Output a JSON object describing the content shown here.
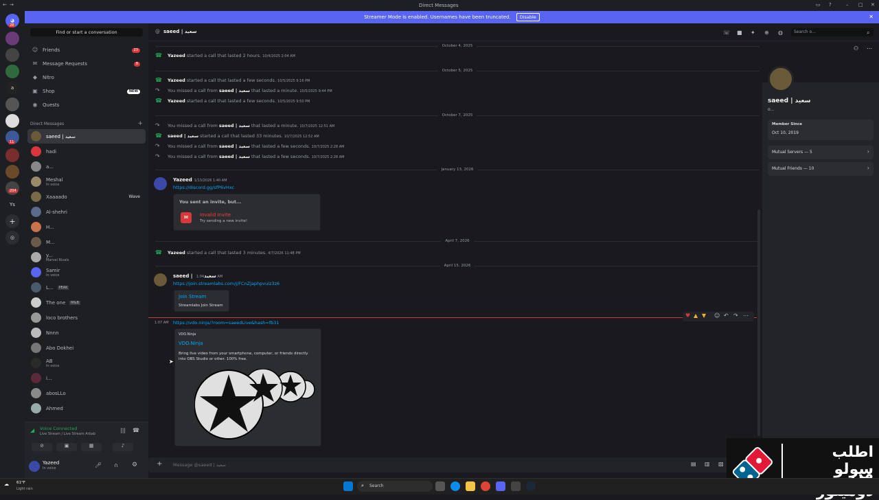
{
  "titlebar": {
    "title": "Direct Messages"
  },
  "banner": {
    "text": "Streamer Mode is enabled. Usernames have been truncated.",
    "button": "Disable"
  },
  "guilds": {
    "badges": [
      "28",
      "11",
      "204"
    ],
    "ys": "Ys"
  },
  "sidebar": {
    "search": "Find or start a conversation",
    "nav": [
      {
        "label": "Friends",
        "badge": "23"
      },
      {
        "label": "Message Requests",
        "badge": "8"
      },
      {
        "label": "Nitro"
      },
      {
        "label": "Shop",
        "badge": "NEW"
      },
      {
        "label": "Quests"
      }
    ],
    "dm_header": "Direct Messages",
    "dms": [
      {
        "name": "saeed | سعيد"
      },
      {
        "name": "hadi"
      },
      {
        "name": "a..."
      },
      {
        "name": "Meshal",
        "sub": "In voice"
      },
      {
        "name": "Xaaaado",
        "wave": "Wave"
      },
      {
        "name": "Al-shehri"
      },
      {
        "name": "H..."
      },
      {
        "name": "M..."
      },
      {
        "name": "y...",
        "sub": "Marvel Rivals"
      },
      {
        "name": "Samir",
        "sub": "In voice"
      },
      {
        "name": "L...",
        "tag": "PEAK"
      },
      {
        "name": "The one",
        "tag": "M&B"
      },
      {
        "name": "loco brothers"
      },
      {
        "name": "Nnnn"
      },
      {
        "name": "Abo Dokhei"
      },
      {
        "name": "AB",
        "sub": "In voice"
      },
      {
        "name": "i..."
      },
      {
        "name": "abosLLo"
      },
      {
        "name": "Ahmed"
      }
    ],
    "voice": {
      "status": "Voice Connected",
      "sub": "Live Stream / Live Stream Arbab"
    },
    "user": {
      "name": "Yazeed",
      "status": "In voice"
    }
  },
  "header": {
    "title": "saeed | سعيد",
    "search": "Search o..."
  },
  "chat": {
    "dates": [
      "October 4, 2025",
      "October 5, 2025",
      "October 7, 2025",
      "January 13, 2026",
      "April 7, 2026",
      "April 15, 2026"
    ],
    "calls": [
      {
        "who": "Yazeed",
        "text": " started a call that lasted 2 hours.",
        "ts": "10/4/2025 2:04 AM",
        "missed": false
      },
      {
        "who": "Yazeed",
        "text": " started a call that lasted a few seconds.",
        "ts": "10/5/2025 9:16 PM",
        "missed": false
      },
      {
        "pre": "You missed a call from ",
        "who": "saeed | سعيد",
        "text": " that lasted a minute.",
        "ts": "10/5/2025 9:44 PM",
        "missed": true
      },
      {
        "who": "Yazeed",
        "text": " started a call that lasted a few seconds.",
        "ts": "10/5/2025 9:50 PM",
        "missed": false
      },
      {
        "pre": "You missed a call from ",
        "who": "saeed | سعيد",
        "text": " that lasted a minute.",
        "ts": "10/7/2025 12:51 AM",
        "missed": true
      },
      {
        "who": "saeed | سعيد",
        "text": " started a call that lasted 33 minutes.",
        "ts": "10/7/2025 12:52 AM",
        "missed": false
      },
      {
        "pre": "You missed a call from ",
        "who": "saeed | سعيد",
        "text": " that lasted a few seconds.",
        "ts": "10/7/2025 2:28 AM",
        "missed": true
      },
      {
        "pre": "You missed a call from ",
        "who": "saeed | سعيد",
        "text": " that lasted a few seconds.",
        "ts": "10/7/2025 2:28 AM",
        "missed": true
      },
      {
        "who": "Yazeed",
        "text": " started a call that lasted 3 minutes.",
        "ts": "4/7/2026 11:48 PM",
        "missed": false
      }
    ],
    "msg1": {
      "author": "Yazeed",
      "ts": "1/13/2026 1:40 AM",
      "link": "https://discord.gg/sfP6vHxc",
      "invite_title": "You sent an invite, but...",
      "invite_name": "Invalid Invite",
      "invite_sub": "Try sending a new invite!"
    },
    "msg2": {
      "author": "saeed | سعيد",
      "ts": "1:04 AM",
      "link": "https://join.streamlabs.com/j/FCnZjaphpvuiz3z6",
      "card_title": "Join Stream",
      "card_sub": "Streamlabs Join Stream"
    },
    "msg3": {
      "ts": "1:07 AM",
      "link": "https://vdo.ninja/?room=saeedLive&hash=fb31",
      "site": "VDO.Ninja",
      "title": "VDO.Ninja",
      "desc": "Bring live video from your smartphone, computer, or friends directly into OBS Studio or other. 100% free."
    }
  },
  "compose": {
    "placeholder": "Message @saeed | سعيد"
  },
  "profile": {
    "name": "saeed | سعيد",
    "sub": "o...",
    "member_since_label": "Member Since",
    "member_since": "Oct 10, 2019",
    "mutual_servers": "Mutual Servers — 5",
    "mutual_friends": "Mutual Friends — 10"
  },
  "taskbar": {
    "weather": "61°F",
    "weather_sub": "Light rain",
    "search": "Search"
  },
  "ad": {
    "line1": "اطلب سولو",
    "line2": "من دومينوز"
  }
}
